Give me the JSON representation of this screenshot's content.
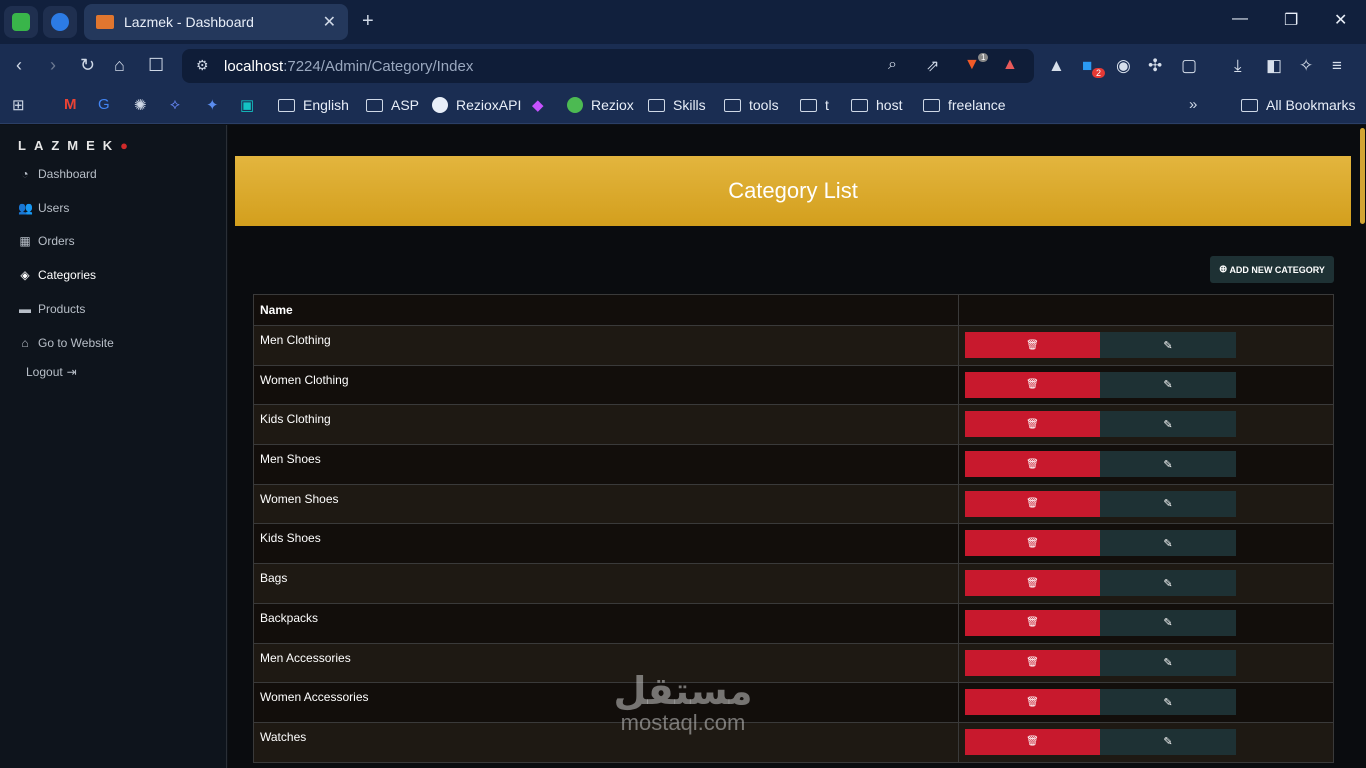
{
  "browser": {
    "tab_title": "Lazmek - Dashboard",
    "tab_close": "✕",
    "new_tab": "+",
    "url_host": "localhost",
    "url_path": ":7224/Admin/Category/Index",
    "notif_badge_1": "1",
    "notif_badge_2": "2",
    "bookmarks": [
      {
        "label": "English",
        "type": "folder"
      },
      {
        "label": "ASP",
        "type": "folder"
      },
      {
        "label": "RezioxAPI",
        "type": "github"
      },
      {
        "label": "Reziox",
        "type": "site"
      },
      {
        "label": "Skills",
        "type": "folder"
      },
      {
        "label": "tools",
        "type": "folder"
      },
      {
        "label": "t",
        "type": "folder"
      },
      {
        "label": "host",
        "type": "folder"
      },
      {
        "label": "freelance",
        "type": "folder"
      }
    ],
    "all_bookmarks": "All Bookmarks"
  },
  "sidebar": {
    "brand": "LAZMEK",
    "items": [
      {
        "label": "Dashboard",
        "icon": "dashboard-icon"
      },
      {
        "label": "Users",
        "icon": "users-icon"
      },
      {
        "label": "Orders",
        "icon": "table-icon"
      },
      {
        "label": "Categories",
        "icon": "tags-icon",
        "active": true
      },
      {
        "label": "Products",
        "icon": "box-icon"
      },
      {
        "label": "Go to Website",
        "icon": "home-icon"
      }
    ],
    "logout": "Logout"
  },
  "main": {
    "title": "Category List",
    "add_button": "ADD NEW CATEGORY",
    "table": {
      "headers": [
        "Name",
        ""
      ],
      "rows": [
        "Men Clothing",
        "Women Clothing",
        "Kids Clothing",
        "Men Shoes",
        "Women Shoes",
        "Kids Shoes",
        "Bags",
        "Backpacks",
        "Men Accessories",
        "Women Accessories",
        "Watches"
      ]
    }
  },
  "watermark": {
    "arabic": "مستقل",
    "latin": "mostaql.com"
  },
  "colors": {
    "header_gold": "#d9a526",
    "delete_red": "#c8192d",
    "edit_dark": "#1e3134"
  }
}
